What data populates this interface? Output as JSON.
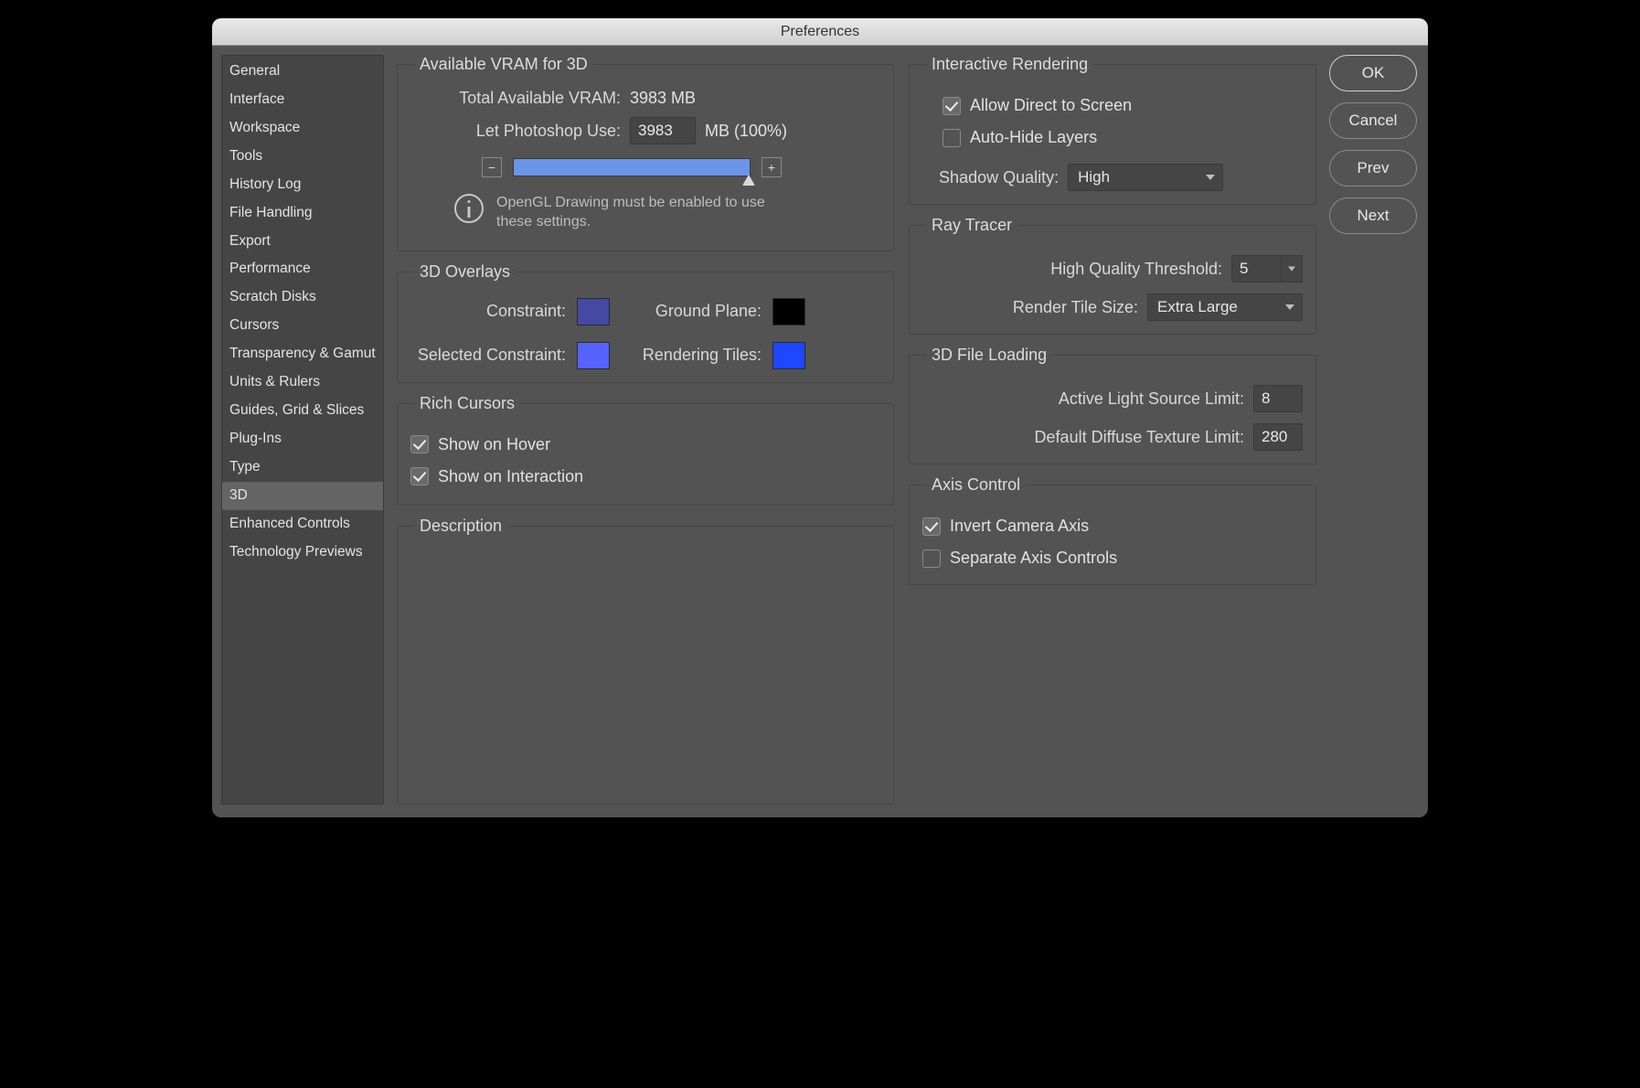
{
  "window": {
    "title": "Preferences"
  },
  "sidebar": {
    "items": [
      "General",
      "Interface",
      "Workspace",
      "Tools",
      "History Log",
      "File Handling",
      "Export",
      "Performance",
      "Scratch Disks",
      "Cursors",
      "Transparency & Gamut",
      "Units & Rulers",
      "Guides, Grid & Slices",
      "Plug-Ins",
      "Type",
      "3D",
      "Enhanced Controls",
      "Technology Previews"
    ],
    "selected": "3D"
  },
  "buttons": {
    "ok": "OK",
    "cancel": "Cancel",
    "prev": "Prev",
    "next": "Next"
  },
  "vram": {
    "group": "Available VRAM for 3D",
    "total_label": "Total Available VRAM:",
    "total_value": "3983 MB",
    "let_label": "Let Photoshop Use:",
    "let_value": "3983",
    "unit_pct": "MB (100%)",
    "minus": "−",
    "plus": "+",
    "info": "OpenGL Drawing must be enabled to use these settings."
  },
  "overlays": {
    "group": "3D Overlays",
    "constraint_label": "Constraint:",
    "constraint_color": "#4549a3",
    "ground_label": "Ground Plane:",
    "ground_color": "#000000",
    "sel_constraint_label": "Selected Constraint:",
    "sel_constraint_color": "#5763ff",
    "tiles_label": "Rendering Tiles:",
    "tiles_color": "#1f47ff"
  },
  "rich": {
    "group": "Rich Cursors",
    "hover": "Show on Hover",
    "interaction": "Show on Interaction"
  },
  "desc": {
    "group": "Description"
  },
  "rendering": {
    "group": "Interactive Rendering",
    "direct": "Allow Direct to Screen",
    "autohide": "Auto-Hide Layers",
    "shadow_label": "Shadow Quality:",
    "shadow_value": "High"
  },
  "raytracer": {
    "group": "Ray Tracer",
    "hq_label": "High Quality Threshold:",
    "hq_value": "5",
    "tile_label": "Render Tile Size:",
    "tile_value": "Extra Large"
  },
  "loading": {
    "group": "3D File Loading",
    "light_label": "Active Light Source Limit:",
    "light_value": "8",
    "diffuse_label": "Default Diffuse Texture Limit:",
    "diffuse_value": "280"
  },
  "axis": {
    "group": "Axis Control",
    "invert": "Invert Camera Axis",
    "separate": "Separate Axis Controls"
  }
}
